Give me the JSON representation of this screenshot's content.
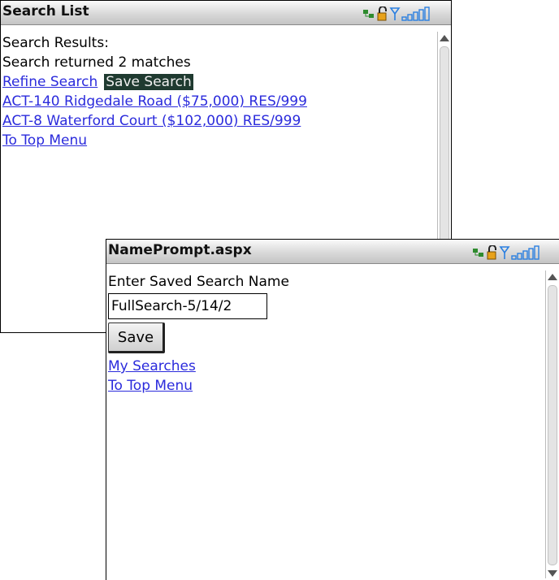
{
  "background_window": {
    "title": "Search List",
    "status_icons": [
      "network-icon",
      "lock-icon",
      "antenna-icon",
      "signal-bars-icon"
    ],
    "heading": "Search Results:",
    "match_text": "Search returned 2 matches",
    "actions": {
      "refine": "Refine Search",
      "save": "Save Search"
    },
    "results": [
      "ACT-140 Ridgedale Road ($75,000) RES/999",
      "ACT-8 Waterford Court ($102,000) RES/999"
    ],
    "top_menu": "To Top Menu"
  },
  "foreground_window": {
    "title": "NamePrompt.aspx",
    "status_icons": [
      "network-icon",
      "lock-icon",
      "antenna-icon",
      "signal-bars-icon"
    ],
    "prompt": "Enter Saved Search Name",
    "name_input_value": "FullSearch-5/14/2",
    "save_label": "Save",
    "my_searches": "My Searches",
    "top_menu": "To Top Menu"
  },
  "colors": {
    "link": "#2b2bdc",
    "selected_bg": "#1f3a30",
    "signal_blue": "#2a7fe0"
  }
}
